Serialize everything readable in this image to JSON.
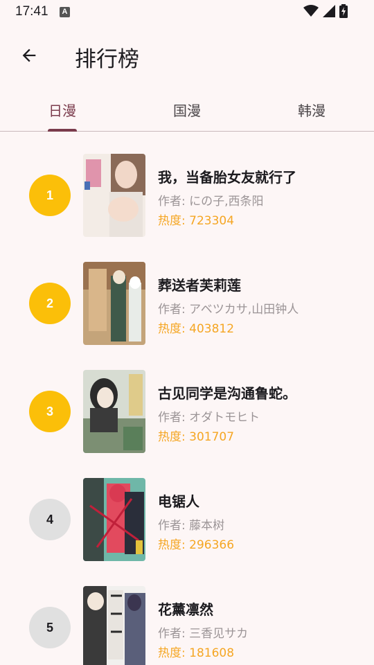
{
  "status": {
    "time": "17:41",
    "notification_letter": "A"
  },
  "header": {
    "title": "排行榜"
  },
  "tabs": [
    {
      "label": "日漫",
      "active": true
    },
    {
      "label": "国漫",
      "active": false
    },
    {
      "label": "韩漫",
      "active": false
    }
  ],
  "author_prefix": "作者: ",
  "heat_prefix": "热度: ",
  "colors": {
    "accent": "#7a3b4c",
    "gold": "#fbbf09",
    "gray": "#e0e0e0",
    "heat": "#f5a623"
  },
  "items": [
    {
      "rank": "1",
      "title": "我，当备胎女友就行了",
      "author": "作者: にの子,西条阳",
      "heat": "热度: 723304"
    },
    {
      "rank": "2",
      "title": "葬送者芙莉莲",
      "author": "作者: アベツカサ,山田钟人",
      "heat": "热度: 403812"
    },
    {
      "rank": "3",
      "title": "古见同学是沟通鲁蛇。",
      "author": "作者: オダトモヒト",
      "heat": "热度: 301707"
    },
    {
      "rank": "4",
      "title": "电锯人",
      "author": "作者: 藤本树",
      "heat": "热度: 296366"
    },
    {
      "rank": "5",
      "title": "花薰凛然",
      "author": "作者: 三香见サカ",
      "heat": "热度: 181608"
    }
  ]
}
